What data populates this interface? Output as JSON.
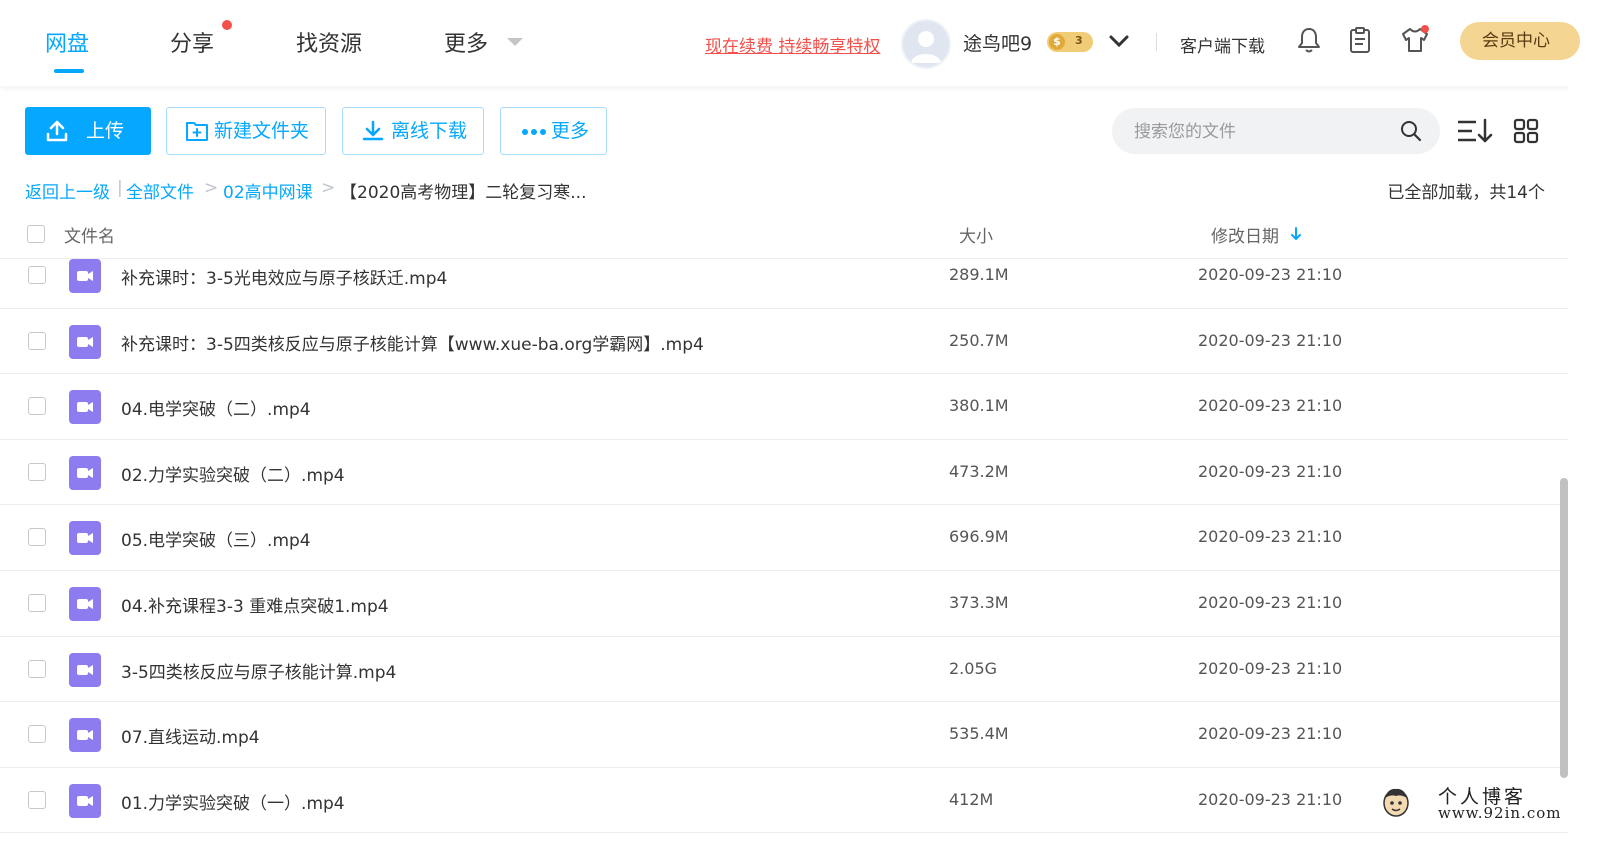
{
  "nav": {
    "tabs": [
      {
        "label": "网盘"
      },
      {
        "label": "分享"
      },
      {
        "label": "找资源"
      },
      {
        "label": "更多"
      }
    ],
    "active_index": 0
  },
  "header": {
    "renew_link": "现在续费 持续畅享特权",
    "username": "途鸟吧9",
    "vip_level": "3",
    "client_download": "客户端下载",
    "vip_center": "会员中心",
    "icons": [
      "bell-icon",
      "clipboard-icon",
      "shirt-icon"
    ]
  },
  "toolbar": {
    "upload": "上传",
    "new_folder": "新建文件夹",
    "offline_download": "离线下载",
    "more": "更多",
    "search_placeholder": "搜索您的文件"
  },
  "breadcrumb": {
    "back": "返回上一级",
    "separator": "|",
    "all_files": "全部文件",
    "arrow": ">",
    "folder": "02高中网课",
    "current": "【2020高考物理】二轮复习寒..."
  },
  "status": "已全部加载，共14个",
  "columns": {
    "name": "文件名",
    "size": "大小",
    "date": "修改日期"
  },
  "files": [
    {
      "name": "补充课时：3-5光电效应与原子核跃迁.mp4",
      "size": "289.1M",
      "date": "2020-09-23 21:10"
    },
    {
      "name": "补充课时：3-5四类核反应与原子核能计算【www.xue-ba.org学霸网】.mp4",
      "size": "250.7M",
      "date": "2020-09-23 21:10"
    },
    {
      "name": "04.电学突破（二）.mp4",
      "size": "380.1M",
      "date": "2020-09-23 21:10"
    },
    {
      "name": "02.力学实验突破（二）.mp4",
      "size": "473.2M",
      "date": "2020-09-23 21:10"
    },
    {
      "name": "05.电学突破（三）.mp4",
      "size": "696.9M",
      "date": "2020-09-23 21:10"
    },
    {
      "name": "04.补充课程3-3 重难点突破1.mp4",
      "size": "373.3M",
      "date": "2020-09-23 21:10"
    },
    {
      "name": "3-5四类核反应与原子核能计算.mp4",
      "size": "2.05G",
      "date": "2020-09-23 21:10"
    },
    {
      "name": "07.直线运动.mp4",
      "size": "535.4M",
      "date": "2020-09-23 21:10"
    },
    {
      "name": "01.力学实验突破（一）.mp4",
      "size": "412M",
      "date": "2020-09-23 21:10"
    }
  ],
  "watermark": {
    "title": "个人博客",
    "url": "www.92in.com"
  },
  "colors": {
    "accent": "#06a7ff",
    "alert": "#f3504b",
    "video_icon": "#8c7cf0",
    "vip_gold": "#f5d592"
  }
}
